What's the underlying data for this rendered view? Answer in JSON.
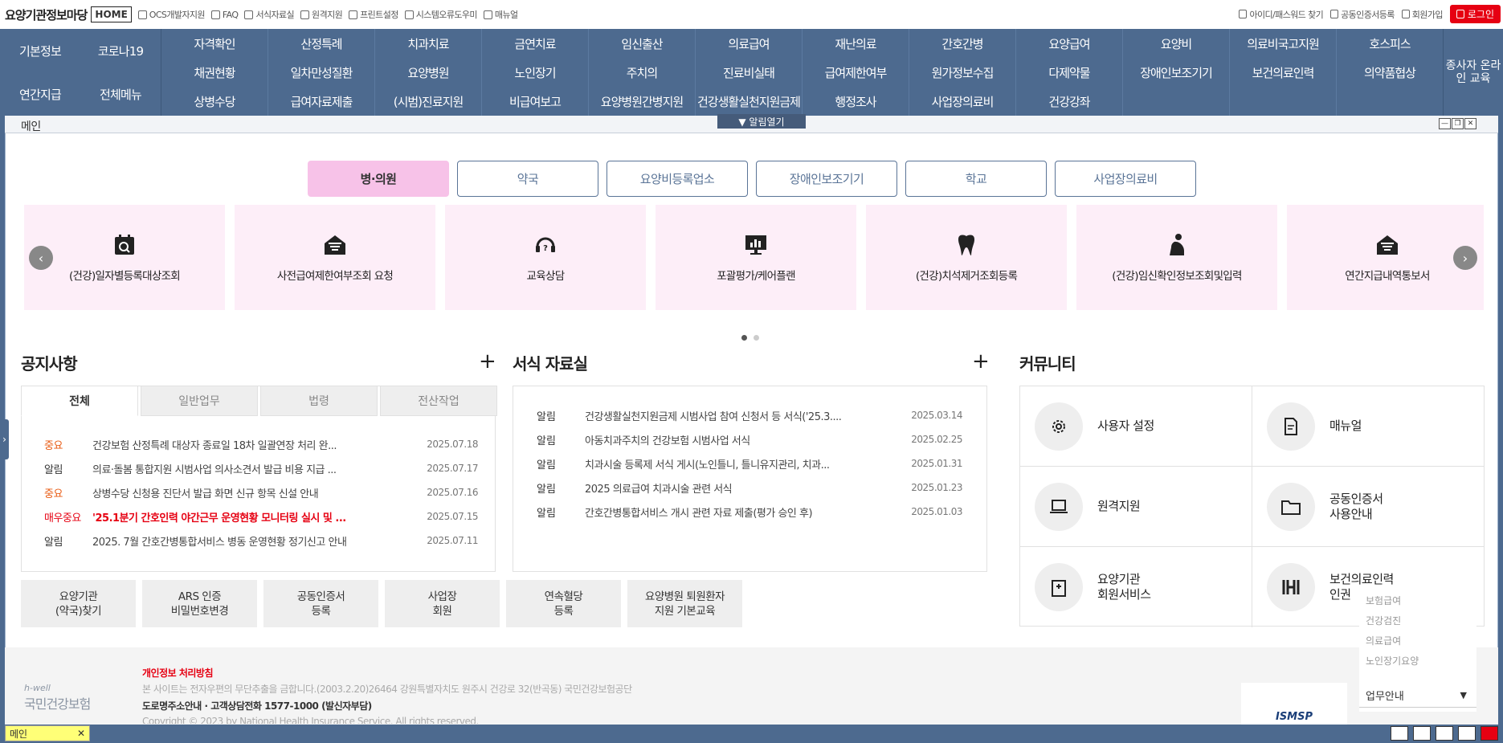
{
  "topbar": {
    "brand": "요양기관정보마당",
    "home": "HOME",
    "links": [
      "OCS개발자지원",
      "FAQ",
      "서식자료실",
      "원격지원",
      "프린트설정",
      "시스템오류도우미",
      "매뉴얼"
    ],
    "right_links": [
      "아이디/패스워드 찾기",
      "공동인증서등록",
      "회원가입"
    ],
    "login": "로그인"
  },
  "nav": {
    "left": [
      "기본정보",
      "코로나19",
      "연간지급",
      "전체메뉴"
    ],
    "items": [
      "자격확인",
      "산정특례",
      "치과치료",
      "금연치료",
      "임신출산",
      "의료급여",
      "재난의료",
      "간호간병",
      "요양급여",
      "요양비",
      "의료비국고지원",
      "호스피스",
      "채권현황",
      "일차만성질환",
      "요양병원",
      "노인장기",
      "주치의",
      "진료비실태",
      "급여제한여부",
      "원가정보수집",
      "다제약물",
      "장애인보조기기",
      "보건의료인력",
      "의약품협상",
      "상병수당",
      "급여자료제출",
      "(시범)진료지원",
      "비급여보고",
      "요양병원간병지원",
      "건강생활실천지원금제",
      "행정조사",
      "사업장의료비",
      "건강강좌",
      "",
      "",
      ""
    ],
    "right": "종사자 온라인 교육"
  },
  "window": {
    "title": "메인",
    "alert_open": "▼ 알림열기"
  },
  "inst_tabs": [
    "병·의원",
    "약국",
    "요양비등록업소",
    "장애인보조기기",
    "학교",
    "사업장의료비"
  ],
  "carousel": [
    {
      "label": "(건강)일자별등록대상조회",
      "icon": "calendar-search-icon"
    },
    {
      "label": "사전급여제한여부조회 요청",
      "icon": "envelope-icon"
    },
    {
      "label": "교육상담",
      "icon": "headset-icon"
    },
    {
      "label": "포괄평가/케어플랜",
      "icon": "monitor-chart-icon"
    },
    {
      "label": "(건강)치석제거조회등록",
      "icon": "tooth-icon"
    },
    {
      "label": "(건강)임신확인정보조회및입력",
      "icon": "pregnant-icon"
    },
    {
      "label": "연간지급내역통보서",
      "icon": "envelope-icon"
    }
  ],
  "notice": {
    "heading": "공지사항",
    "tabs": [
      "전체",
      "일반업무",
      "법령",
      "전산작업"
    ],
    "rows": [
      {
        "tag": "중요",
        "title": "건강보험 산정특례 대상자 종료일 18차 일괄연장 처리 완...",
        "date": "2025.07.18"
      },
      {
        "tag": "알림",
        "title": "의료·돌봄 통합지원 시범사업 의사소견서 발급 비용 지급 ...",
        "date": "2025.07.17"
      },
      {
        "tag": "중요",
        "title": "상병수당 신청용 진단서 발급 화면 신규 항목 신설 안내",
        "date": "2025.07.16"
      },
      {
        "tag": "매우중요",
        "title": "'25.1분기 간호인력 야간근무 운영현황 모니터링 실시 및 ...",
        "date": "2025.07.15"
      },
      {
        "tag": "알림",
        "title": "2025. 7월 간호간병통합서비스 병동 운영현황 정기신고 안내",
        "date": "2025.07.11"
      }
    ]
  },
  "forms": {
    "heading": "서식 자료실",
    "rows": [
      {
        "tag": "알림",
        "title": "건강생활실천지원금제 시범사업 참여 신청서 등 서식('25.3....",
        "date": "2025.03.14"
      },
      {
        "tag": "알림",
        "title": "아동치과주치의 건강보험 시범사업 서식",
        "date": "2025.02.25"
      },
      {
        "tag": "알림",
        "title": "치과시술 등록제 서식 게시(노인틀니, 틀니유지관리, 치과...",
        "date": "2025.01.31"
      },
      {
        "tag": "알림",
        "title": "2025 의료급여 치과시술 관련 서식",
        "date": "2025.01.23"
      },
      {
        "tag": "알림",
        "title": "간호간병통합서비스 개시 관련 자료 제출(평가 승인 후)",
        "date": "2025.01.03"
      }
    ]
  },
  "quick_buttons": [
    "요양기관\n(약국)찾기",
    "ARS 인증\n비밀번호변경",
    "공동인증서\n등록",
    "사업장\n회원",
    "연속혈당\n등록",
    "요양병원 퇴원환자\n지원 기본교육"
  ],
  "community": {
    "heading": "커뮤니티",
    "items": [
      {
        "label": "사용자 설정",
        "icon": "gear-icon"
      },
      {
        "label": "매뉴얼",
        "icon": "document-icon"
      },
      {
        "label": "원격지원",
        "icon": "laptop-icon"
      },
      {
        "label": "공동인증서\n사용안내",
        "icon": "folder-icon"
      },
      {
        "label": "요양기관\n회원서비스",
        "icon": "hospital-icon"
      },
      {
        "label": "보건의료인력\n인권",
        "icon": "people-icon"
      }
    ]
  },
  "dropdown": {
    "options": [
      "보험급여",
      "건강검진",
      "의료급여",
      "노인장기요양"
    ],
    "selected": "업무안내"
  },
  "footer": {
    "privacy": "개인정보 처리방침",
    "logo_small": "h-well",
    "logo_main": "국민건강보험",
    "notice": "본 사이트는 전자우편의 무단추출을 금합니다.(2003.2.20)26464 강원특별자치도 원주시 건강로 32(반곡동) 국민건강보험공단",
    "contact": "도로명주소안내 · 고객상담전화 1577-1000 (발신자부담)",
    "copyright": "Copyright © 2023 by National Health Insurance Service. All rights reserved.",
    "isms": "ISMSP"
  },
  "taskbar": {
    "tab": "메인",
    "close": "✕"
  }
}
